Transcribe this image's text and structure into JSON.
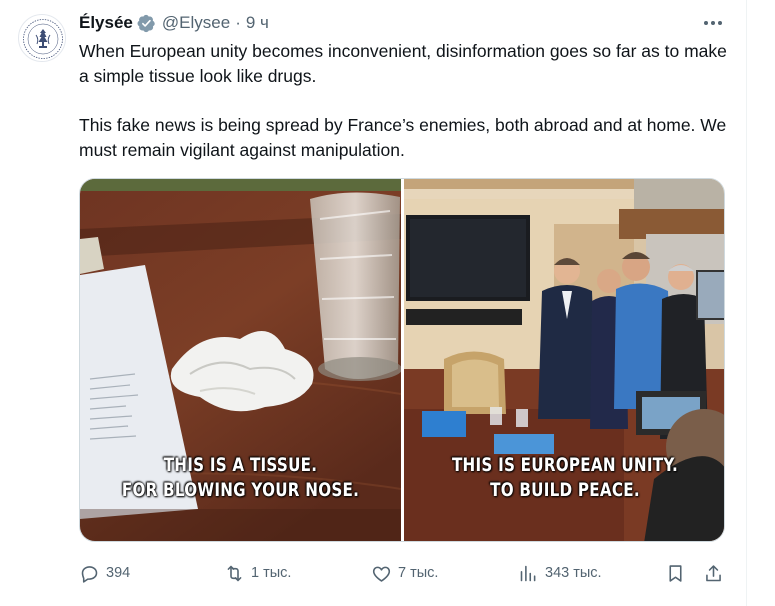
{
  "author": {
    "name": "Élysée",
    "handle": "@Elysee",
    "separator": "·",
    "time": "9 ч"
  },
  "tweet": {
    "paragraphs": [
      "When European unity becomes inconvenient, disinformation goes so far as to make a simple tissue look like drugs.",
      "This fake news is being spread by France’s enemies, both abroad and at home. We must remain vigilant against manipulation."
    ]
  },
  "media": {
    "left_caption": [
      "THIS IS A TISSUE.",
      "FOR BLOWING YOUR NOSE."
    ],
    "right_caption": [
      "THIS IS EUROPEAN UNITY.",
      "TO BUILD PEACE."
    ]
  },
  "actions": {
    "replies": "394",
    "retweets": "1 тыс.",
    "likes": "7 тыс.",
    "views": "343 тыс."
  },
  "colors": {
    "text": "#0f1419",
    "secondary": "#536471",
    "verified_badge": "#829aab",
    "border": "#cfd9de"
  },
  "icons": [
    "verified-badge-icon",
    "more-icon",
    "reply-icon",
    "retweet-icon",
    "like-icon",
    "views-icon",
    "bookmark-icon",
    "share-icon"
  ]
}
